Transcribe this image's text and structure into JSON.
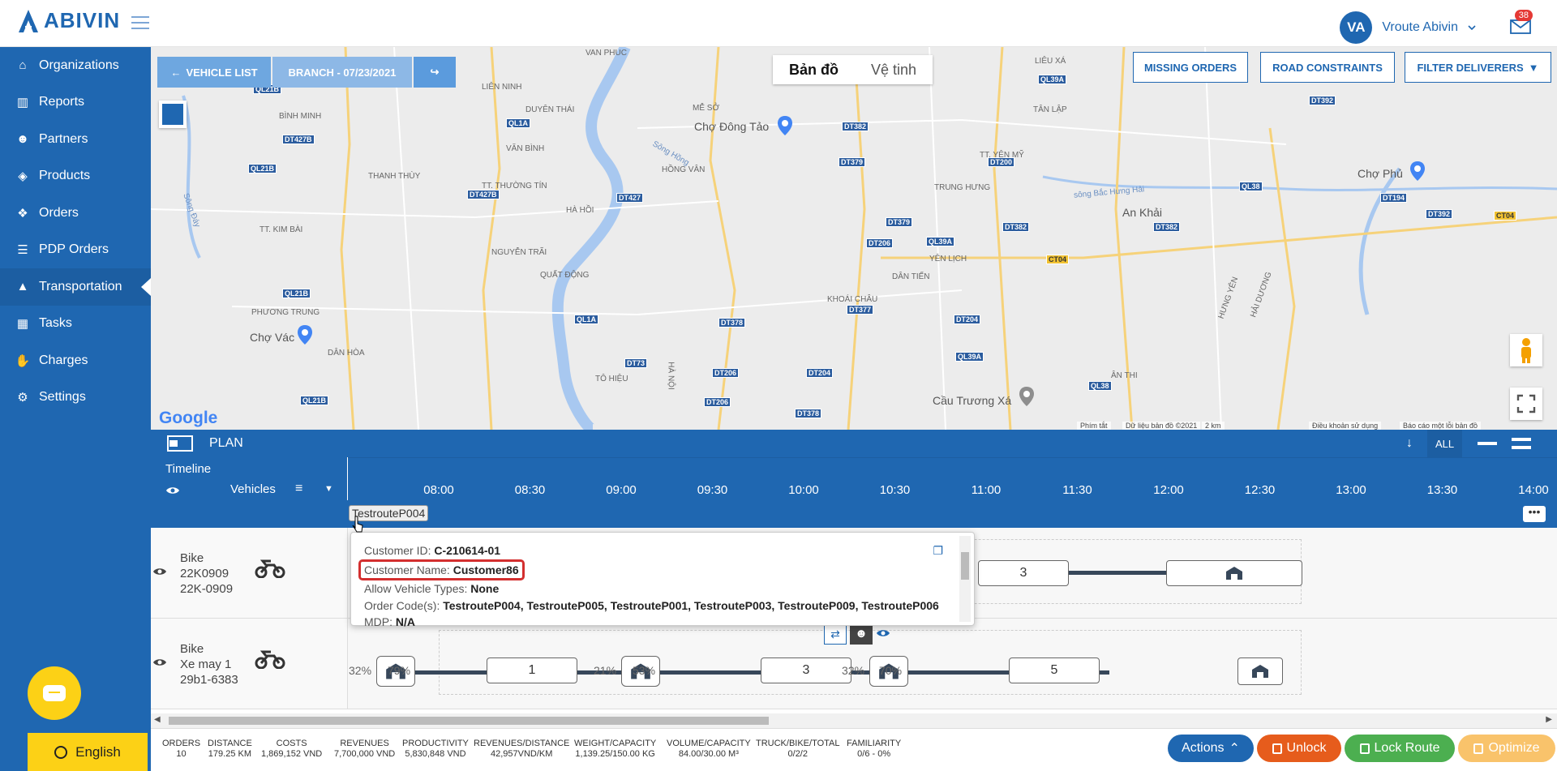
{
  "brand": {
    "name": "ABIVIN"
  },
  "user": {
    "initials": "VA",
    "name": "Vroute Abivin",
    "notifications": "38"
  },
  "sidebar": {
    "items": [
      {
        "label": "Organizations",
        "icon": "home-icon"
      },
      {
        "label": "Reports",
        "icon": "bar-chart-icon"
      },
      {
        "label": "Partners",
        "icon": "users-icon"
      },
      {
        "label": "Products",
        "icon": "dropbox-icon"
      },
      {
        "label": "Orders",
        "icon": "cubes-icon"
      },
      {
        "label": "PDP Orders",
        "icon": "list-icon"
      },
      {
        "label": "Transportation",
        "icon": "road-icon",
        "active": true
      },
      {
        "label": "Tasks",
        "icon": "calendar-icon"
      },
      {
        "label": "Charges",
        "icon": "hand-money-icon"
      },
      {
        "label": "Settings",
        "icon": "gear-icon"
      }
    ],
    "language": "English"
  },
  "map": {
    "toolbar": {
      "vehicle_list": "VEHICLE LIST",
      "branch": "BRANCH - 07/23/2021"
    },
    "map_types": [
      "Bản đồ",
      "Vệ tinh"
    ],
    "buttons": {
      "missing_orders": "MISSING ORDERS",
      "road_constraints": "ROAD CONSTRAINTS",
      "filter_deliverers": "FILTER DELIVERERS"
    },
    "places": [
      "VAN PHUC",
      "LIÊN NINH",
      "DUYÊN THÁI",
      "BÌNH MINH",
      "VĂN BÌNH",
      "THANH THÙY",
      "TT. THƯỜNG TÍN",
      "HÀ HỒI",
      "TT. KIM BÀI",
      "NGUYỄN TRÃI",
      "QUẤT ĐỘNG",
      "PHƯƠNG TRUNG",
      "DÂN HÒA",
      "TÔ HIỆU",
      "MỄ SỞ",
      "HỒNG VÂN",
      "LIÊU XÁ",
      "TÂN LẬP",
      "TT. YÊN MỸ",
      "TRUNG HƯNG",
      "YÊN LỊCH",
      "DÂN TIẾN",
      "KHOÁI CHÂU",
      "ÂN THI",
      "HƯNG YÊN",
      "HẢI DƯƠNG",
      "HÀ NỘI",
      "Sông Hồng",
      "sông Bắc Hưng Hải",
      "Sông Đáy"
    ],
    "big_places": [
      "Chợ Đông Tảo",
      "Chợ Vác",
      "An Khải",
      "Chợ Phủ",
      "Cầu Trương Xá"
    ],
    "attribution": {
      "shortcuts": "Phím tắt",
      "data": "Dữ liệu bản đồ ©2021",
      "scale": "2 km",
      "terms": "Điều khoản sử dụng",
      "report": "Báo cáo một lỗi bản đồ"
    },
    "google": "Google"
  },
  "plan": {
    "title": "PLAN",
    "filter_all": "ALL",
    "timeline_label": "Timeline",
    "vehicles_label": "Vehicles",
    "ticks": [
      "08:00",
      "08:30",
      "09:00",
      "09:30",
      "10:00",
      "10:30",
      "11:00",
      "11:30",
      "12:00",
      "12:30",
      "13:00",
      "13:30",
      "14:00"
    ],
    "route_tag": "TestrouteP004"
  },
  "vehicles": [
    {
      "type": "Bike",
      "line2": "22K0909",
      "line3": "22K-0909"
    },
    {
      "type": "Bike",
      "line2": "Xe may 1",
      "line3": "29b1-6383"
    }
  ],
  "route_row1": {
    "stops": [
      "3"
    ]
  },
  "route_row2": {
    "stops": [
      "1",
      "3",
      "5"
    ],
    "pcts": [
      "32%",
      "79%",
      "21%",
      "53%",
      "32%",
      "70%"
    ]
  },
  "tooltip": {
    "customer_id_label": "Customer ID:",
    "customer_id": "C-210614-01",
    "customer_name_label": "Customer Name:",
    "customer_name": "Customer86",
    "vehicle_types_label": "Allow Vehicle Types:",
    "vehicle_types": "None",
    "order_codes_label": "Order Code(s):",
    "order_codes": "TestrouteP004, TestrouteP005, TestrouteP001, TestrouteP003, TestrouteP009, TestrouteP006",
    "mdp_label": "MDP:",
    "mdp": "N/A"
  },
  "stats": [
    {
      "label": "ORDERS",
      "value": "10"
    },
    {
      "label": "DISTANCE",
      "value": "179.25 KM"
    },
    {
      "label": "COSTS",
      "value": "1,869,152 VND"
    },
    {
      "label": "REVENUES",
      "value": "7,700,000 VND"
    },
    {
      "label": "PRODUCTIVITY",
      "value": "5,830,848 VND"
    },
    {
      "label": "REVENUES/DISTANCE",
      "value": "42,957VND/KM"
    },
    {
      "label": "WEIGHT/CAPACITY",
      "value": "1,139.25/150.00 KG"
    },
    {
      "label": "VOLUME/CAPACITY",
      "value": "84.00/30.00 M³"
    },
    {
      "label": "TRUCK/BIKE/TOTAL",
      "value": "0/2/2"
    },
    {
      "label": "FAMILIARITY",
      "value": "0/6 - 0%"
    }
  ],
  "actions": {
    "actions": "Actions",
    "unlock": "Unlock",
    "lock_route": "Lock Route",
    "optimize": "Optimize"
  },
  "colors": {
    "primary": "#1f67b1",
    "actions": "#1f67b1",
    "unlock": "#e65c1c",
    "lock_route": "#4caf50",
    "optimize": "#f9c36b"
  }
}
